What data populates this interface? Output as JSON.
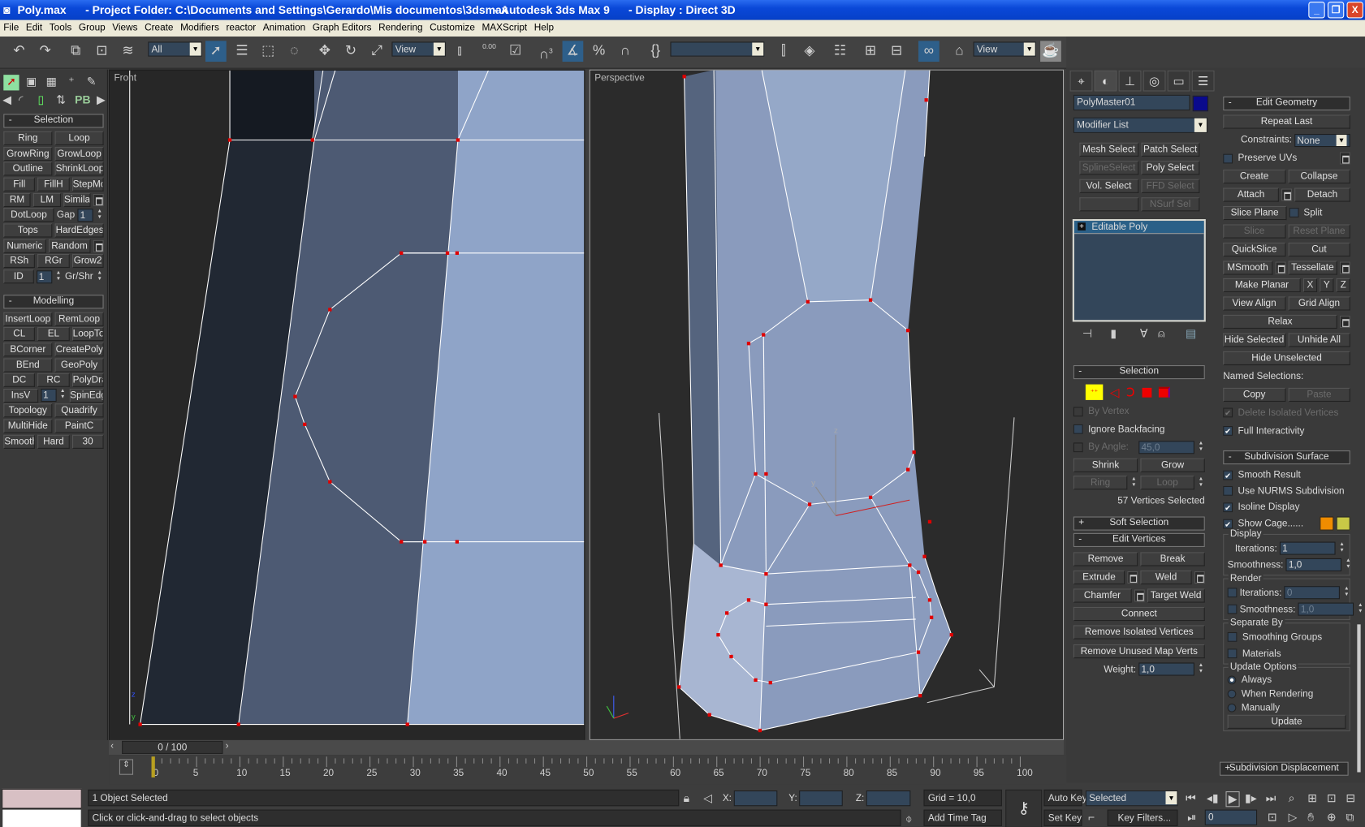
{
  "window": {
    "title_parts": [
      "Poly.max",
      "- Project Folder: C:\\Documents and Settings\\Gerardo\\Mis documentos\\3dsmax",
      "- Autodesk 3ds Max 9",
      "- Display : Direct 3D"
    ],
    "controls": [
      "minimize",
      "restore",
      "close"
    ]
  },
  "menu": [
    "File",
    "Edit",
    "Tools",
    "Group",
    "Views",
    "Create",
    "Modifiers",
    "reactor",
    "Animation",
    "Graph Editors",
    "Rendering",
    "Customize",
    "MAXScript",
    "Help"
  ],
  "toolbar": {
    "selection_filter": "All",
    "ref_coord": "View",
    "spinner_snap_label": "0.00",
    "snap_label": "3",
    "named_sets": "",
    "render_view": "View",
    "active_tools": [
      "select-object",
      "percent-snap",
      "schematic-view"
    ]
  },
  "left_panel": {
    "selection_title": "Selection",
    "selection_rows": [
      [
        {
          "type": "btn",
          "label": "Ring"
        },
        {
          "type": "btn",
          "label": "Loop"
        }
      ],
      [
        {
          "type": "btn",
          "label": "GrowRing"
        },
        {
          "type": "btn",
          "label": "GrowLoop"
        }
      ],
      [
        {
          "type": "btn",
          "label": "Outline"
        },
        {
          "type": "btn",
          "label": "ShrinkLoop"
        }
      ],
      [
        {
          "type": "btn",
          "label": "Fill"
        },
        {
          "type": "btn",
          "label": "FillH"
        },
        {
          "type": "btn",
          "label": "StepMode"
        }
      ],
      [
        {
          "type": "btn",
          "label": "RM"
        },
        {
          "type": "btn",
          "label": "LM"
        },
        {
          "type": "btn",
          "label": "Similar"
        },
        {
          "type": "opt"
        }
      ],
      [
        {
          "type": "btn",
          "label": "DotLoop"
        },
        {
          "type": "spin",
          "label": "Gap",
          "value": "1",
          "short": true
        }
      ],
      [
        {
          "type": "btn",
          "label": "Tops"
        },
        {
          "type": "btn",
          "label": "HardEdges"
        }
      ],
      [
        {
          "type": "btn",
          "label": "Numeric"
        },
        {
          "type": "btn",
          "label": "Random"
        },
        {
          "type": "opt"
        }
      ],
      [
        {
          "type": "btn",
          "label": "RSh"
        },
        {
          "type": "btn",
          "label": "RGr"
        },
        {
          "type": "btn",
          "label": "Grow2"
        }
      ],
      [
        {
          "type": "btn",
          "label": "ID"
        },
        {
          "type": "spin",
          "label": "",
          "value": "1",
          "short": true
        },
        {
          "type": "spin",
          "label": "Gr/Shr",
          "value": null
        }
      ]
    ],
    "modelling_title": "Modelling",
    "modelling_rows": [
      [
        {
          "type": "btn",
          "label": "InsertLoop"
        },
        {
          "type": "btn",
          "label": "RemLoop"
        }
      ],
      [
        {
          "type": "btn",
          "label": "CL"
        },
        {
          "type": "btn",
          "label": "EL"
        },
        {
          "type": "btn",
          "label": "LoopTools"
        }
      ],
      [
        {
          "type": "btn",
          "label": "BCorner"
        },
        {
          "type": "btn",
          "label": "CreatePoly"
        }
      ],
      [
        {
          "type": "btn",
          "label": "BEnd"
        },
        {
          "type": "btn",
          "label": "GeoPoly"
        }
      ],
      [
        {
          "type": "btn",
          "label": "DC"
        },
        {
          "type": "btn",
          "label": "RC"
        },
        {
          "type": "btn",
          "label": "PolyDraw"
        }
      ],
      [
        {
          "type": "btn",
          "label": "InsV"
        },
        {
          "type": "spin",
          "label": "",
          "value": "1",
          "short": true
        },
        {
          "type": "btn",
          "label": "SpinEdge"
        }
      ],
      [
        {
          "type": "btn",
          "label": "Topology"
        },
        {
          "type": "btn",
          "label": "Quadrify"
        }
      ],
      [
        {
          "type": "btn",
          "label": "MultiHide"
        },
        {
          "type": "btn",
          "label": "PaintC"
        }
      ],
      [
        {
          "type": "btn",
          "label": "Smooth"
        },
        {
          "type": "btn",
          "label": "Hard"
        },
        {
          "type": "btn",
          "label": "30"
        }
      ]
    ]
  },
  "viewports": {
    "front_label": "Front",
    "perspective_label": "Perspective"
  },
  "command_panel": {
    "tabs": [
      "create",
      "modify",
      "hierarchy",
      "motion",
      "display",
      "utilities"
    ],
    "object_name": "PolyMaster01",
    "object_color": "#0a0a8c",
    "modifier_list": "Modifier List",
    "modifier_buttons": [
      [
        {
          "type": "btn",
          "label": "Mesh Select"
        },
        {
          "type": "btn",
          "label": "Patch Select"
        }
      ],
      [
        {
          "type": "btn",
          "label": "SplineSelect",
          "disabled": true
        },
        {
          "type": "btn",
          "label": "Poly Select"
        }
      ],
      [
        {
          "type": "btn",
          "label": "Vol. Select"
        },
        {
          "type": "btn",
          "label": "FFD Select",
          "disabled": true
        }
      ],
      [
        {
          "type": "btn",
          "label": ""
        },
        {
          "type": "btn",
          "label": "NSurf Sel",
          "disabled": true
        }
      ]
    ],
    "stack_item": "Editable Poly",
    "selection": {
      "title": "Selection",
      "rows": [
        [
          {
            "type": "check",
            "label": "By Vertex",
            "checked": false,
            "disabled": true
          }
        ],
        [
          {
            "type": "check",
            "label": "Ignore Backfacing",
            "checked": false
          }
        ],
        [
          {
            "type": "check",
            "label": "By Angle:",
            "checked": false,
            "disabled": true
          },
          {
            "type": "spin",
            "label": "",
            "value": "45,0",
            "disabled": true
          }
        ],
        [
          {
            "type": "btn",
            "label": "Shrink"
          },
          {
            "type": "btn",
            "label": "Grow"
          }
        ],
        [
          {
            "type": "btn",
            "label": "Ring",
            "disabled": true
          },
          {
            "type": "spin",
            "label": "",
            "value": null
          },
          {
            "type": "btn",
            "label": "Loop",
            "disabled": true
          },
          {
            "type": "spin",
            "label": "",
            "value": null
          }
        ],
        [
          {
            "type": "text",
            "label": "57 Vertices Selected",
            "right": true
          }
        ]
      ]
    },
    "soft_selection_title": "Soft Selection",
    "edit_vertices": {
      "title": "Edit Vertices",
      "rows": [
        [
          {
            "type": "btn",
            "label": "Remove"
          },
          {
            "type": "btn",
            "label": "Break"
          }
        ],
        [
          {
            "type": "btn",
            "label": "Extrude"
          },
          {
            "type": "opt"
          },
          {
            "type": "btn",
            "label": "Weld"
          },
          {
            "type": "opt"
          }
        ],
        [
          {
            "type": "btn",
            "label": "Chamfer"
          },
          {
            "type": "opt"
          },
          {
            "type": "btn",
            "label": "Target Weld"
          }
        ],
        [
          {
            "type": "btn",
            "label": "Connect"
          }
        ],
        [
          {
            "type": "btn",
            "label": "Remove Isolated Vertices"
          }
        ],
        [
          {
            "type": "btn",
            "label": "Remove Unused Map Verts"
          }
        ],
        [
          {
            "type": "spin",
            "label": "Weight:",
            "value": "1,0"
          }
        ]
      ]
    },
    "edit_geometry": {
      "title": "Edit Geometry",
      "rows": [
        [
          {
            "type": "btn",
            "label": "Repeat Last"
          }
        ],
        [
          {
            "type": "drop",
            "label": "Constraints:",
            "value": "None"
          }
        ],
        [
          {
            "type": "check",
            "label": "Preserve UVs",
            "checked": false
          },
          {
            "type": "opt"
          }
        ],
        [
          {
            "type": "btn",
            "label": "Create"
          },
          {
            "type": "btn",
            "label": "Collapse"
          }
        ],
        [
          {
            "type": "btn",
            "label": "Attach"
          },
          {
            "type": "opt"
          },
          {
            "type": "btn",
            "label": "Detach"
          }
        ],
        [
          {
            "type": "btn",
            "label": "Slice Plane"
          },
          {
            "type": "check",
            "label": "Split",
            "checked": false
          }
        ],
        [
          {
            "type": "btn",
            "label": "Slice",
            "disabled": true
          },
          {
            "type": "btn",
            "label": "Reset Plane",
            "disabled": true
          }
        ],
        [
          {
            "type": "btn",
            "label": "QuickSlice"
          },
          {
            "type": "btn",
            "label": "Cut"
          }
        ],
        [
          {
            "type": "btn",
            "label": "MSmooth"
          },
          {
            "type": "opt"
          },
          {
            "type": "btn",
            "label": "Tessellate"
          },
          {
            "type": "opt"
          }
        ],
        [
          {
            "type": "btn",
            "label": "Make Planar"
          },
          {
            "type": "mini",
            "label": "X"
          },
          {
            "type": "mini",
            "label": "Y"
          },
          {
            "type": "mini",
            "label": "Z"
          }
        ],
        [
          {
            "type": "btn",
            "label": "View Align"
          },
          {
            "type": "btn",
            "label": "Grid Align"
          }
        ],
        [
          {
            "type": "btn",
            "label": "Relax"
          },
          {
            "type": "opt"
          }
        ],
        [
          {
            "type": "btn",
            "label": "Hide Selected"
          },
          {
            "type": "btn",
            "label": "Unhide All"
          }
        ],
        [
          {
            "type": "btn",
            "label": "Hide Unselected"
          }
        ],
        [
          {
            "type": "text",
            "label": "Named Selections:"
          }
        ],
        [
          {
            "type": "btn",
            "label": "Copy"
          },
          {
            "type": "btn",
            "label": "Paste",
            "disabled": true
          }
        ],
        [
          {
            "type": "check",
            "label": "Delete Isolated Vertices",
            "checked": true,
            "disabled": true
          }
        ],
        [
          {
            "type": "check",
            "label": "Full Interactivity",
            "checked": true
          }
        ]
      ]
    },
    "subdivision_surface": {
      "title": "Subdivision Surface",
      "rows": [
        [
          {
            "type": "check",
            "label": "Smooth Result",
            "checked": true
          }
        ],
        [
          {
            "type": "check",
            "label": "Use NURMS Subdivision",
            "checked": false
          }
        ],
        [
          {
            "type": "check",
            "label": "Isoline Display",
            "checked": true
          }
        ],
        [
          {
            "type": "check",
            "label": "Show Cage......",
            "checked": true
          },
          {
            "type": "swatch",
            "color": "#f08c00"
          },
          {
            "type": "swatch",
            "color": "#c8c846"
          }
        ]
      ],
      "groups": [
        {
          "title": "Display",
          "rows": [
            [
              {
                "type": "spin",
                "label": "Iterations:",
                "value": "1"
              }
            ],
            [
              {
                "type": "spin",
                "label": "Smoothness:",
                "value": "1,0"
              }
            ]
          ]
        },
        {
          "title": "Render",
          "rows": [
            [
              {
                "type": "check",
                "label": "",
                "checked": false
              },
              {
                "type": "spin",
                "label": "Iterations:",
                "value": "0",
                "disabled": true
              }
            ],
            [
              {
                "type": "check",
                "label": "",
                "checked": false
              },
              {
                "type": "spin",
                "label": "Smoothness:",
                "value": "1,0",
                "disabled": true
              }
            ]
          ]
        },
        {
          "title": "Separate By",
          "rows": [
            [
              {
                "type": "check",
                "label": "Smoothing Groups",
                "checked": false
              }
            ],
            [
              {
                "type": "check",
                "label": "Materials",
                "checked": false
              }
            ]
          ]
        },
        {
          "title": "Update Options",
          "rows": [
            [
              {
                "type": "radio",
                "label": "Always",
                "checked": true
              }
            ],
            [
              {
                "type": "radio",
                "label": "When Rendering",
                "checked": false
              }
            ],
            [
              {
                "type": "radio",
                "label": "Manually",
                "checked": false
              }
            ],
            [
              {
                "type": "btn",
                "label": "Update"
              }
            ]
          ]
        }
      ]
    },
    "subdivision_displacement_title": "Subdivision Displacement"
  },
  "timeline": {
    "slider_label": "0 / 100",
    "current_frame": 0,
    "ticks": [
      0,
      5,
      10,
      15,
      20,
      25,
      30,
      35,
      40,
      45,
      50,
      55,
      60,
      65,
      70,
      75,
      80,
      85,
      90,
      95,
      100
    ]
  },
  "status": {
    "selection_info": "1 Object Selected",
    "prompt": "Click or click-and-drag to select objects",
    "x_label": "X:",
    "y_label": "Y:",
    "z_label": "Z:",
    "grid": "Grid = 10,0",
    "add_time_tag": "Add Time Tag",
    "auto_key": "Auto Key",
    "set_key": "Set Key",
    "key_mode": "Selected",
    "key_filters": "Key Filters...",
    "frame": "0",
    "swatch_top": "#d8c0c4",
    "swatch_bottom": "#ffffff"
  }
}
